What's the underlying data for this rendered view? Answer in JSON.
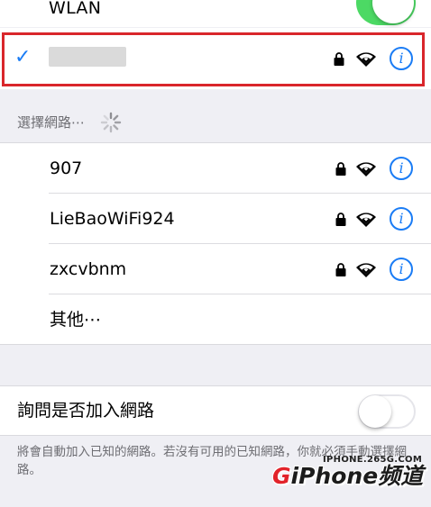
{
  "wlan": {
    "label": "WLAN",
    "enabled": true
  },
  "connected_network": {
    "check": "✓",
    "name_redacted": true
  },
  "section_header": {
    "label": "選擇網路⋯"
  },
  "networks": [
    {
      "name": "907",
      "locked": true,
      "info": "i"
    },
    {
      "name": "LieBaoWiFi924",
      "locked": true,
      "info": "i"
    },
    {
      "name": "zxcvbnm",
      "locked": true,
      "info": "i"
    }
  ],
  "other_label": "其他⋯",
  "ask_to_join": {
    "label": "詢問是否加入網路",
    "enabled": false
  },
  "footer_note": "將會自動加入已知的網路。若沒有可用的已知網路，你就必須手動選擇網路。",
  "watermark": {
    "url": "IPHONE.265G.COM",
    "logo_g": "G",
    "logo_rest": "iPhone频道"
  },
  "colors": {
    "accent": "#1a7cf5",
    "toggle_on": "#4cd964",
    "highlight_border": "#d9262b",
    "background": "#efeff4"
  },
  "icons": {
    "lock": "lock-icon",
    "wifi": "wifi-icon",
    "info": "info-icon",
    "checkmark": "checkmark-icon",
    "spinner": "loading-spinner-icon"
  }
}
